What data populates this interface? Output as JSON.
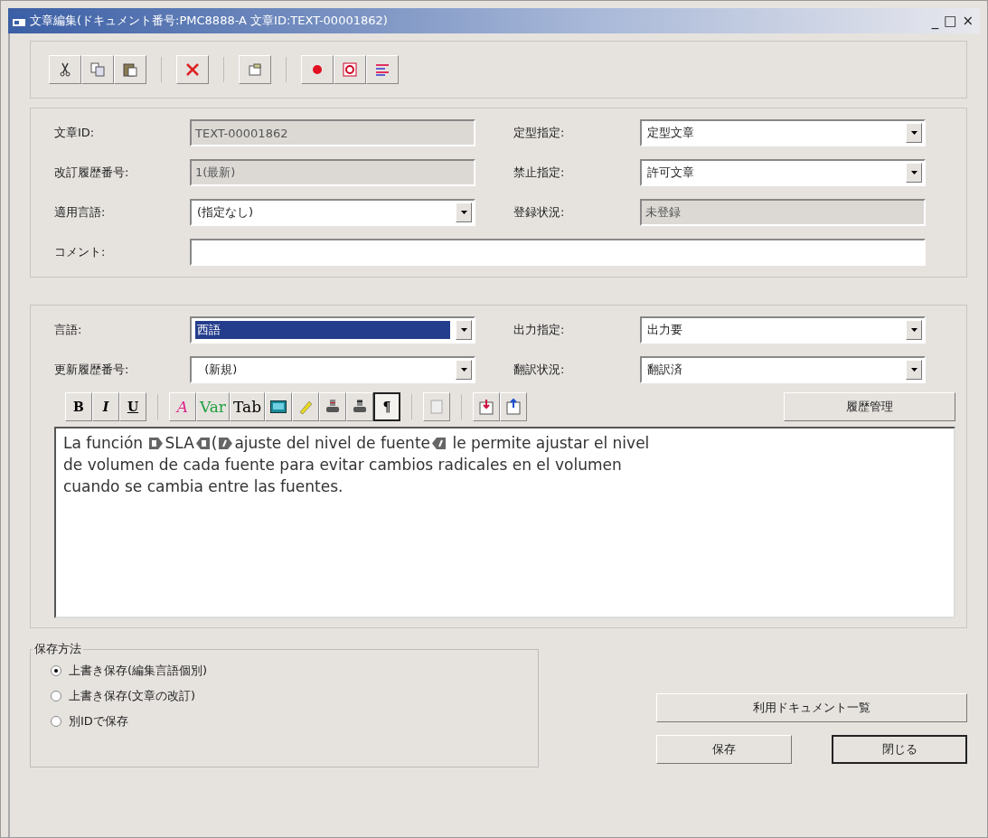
{
  "window": {
    "title": "文章編集(ドキュメント番号:PMC8888-A  文章ID:TEXT-00001862)",
    "controls": [
      "_",
      "□",
      "×"
    ]
  },
  "header_fields": [
    {
      "label": "文章ID:",
      "kind": "readonly",
      "value": "TEXT-00001862"
    },
    {
      "label": "定型指定:",
      "kind": "dropdown",
      "value": "定型文章"
    },
    {
      "label": "改訂履歴番号:",
      "kind": "readonly",
      "value": "1(最新)"
    },
    {
      "label": "禁止指定:",
      "kind": "dropdown",
      "value": "許可文章"
    },
    {
      "label": "適用言語:",
      "kind": "dropdown",
      "value": "(指定なし)"
    },
    {
      "label": "登録状況:",
      "kind": "readonly",
      "value": "未登録"
    }
  ],
  "comment": {
    "label": "コメント:"
  },
  "language_fields": [
    {
      "label": "言語:",
      "value": "西語",
      "highlighted": true
    },
    {
      "label": "出力指定:",
      "value": "出力要",
      "highlighted": false
    },
    {
      "label": "更新履歴番号:",
      "value": "  (新規)",
      "highlighted": false
    },
    {
      "label": "翻訳状況:",
      "value": "翻訳済",
      "highlighted": false
    }
  ],
  "format_toolbar": {
    "style_buttons": [
      "B",
      "I",
      "U"
    ],
    "insert_buttons": [
      "A",
      "Var",
      "Tab"
    ],
    "pilcrow": "¶",
    "pilcrow_pressed": true,
    "history_button": "履歴管理"
  },
  "editor": [
    [
      {
        "kind": "text",
        "text": "La función "
      },
      {
        "kind": "bold_open"
      },
      {
        "kind": "text",
        "text": "SLA"
      },
      {
        "kind": "bold_close"
      },
      {
        "kind": "text",
        "text": "("
      },
      {
        "kind": "italic_open"
      },
      {
        "kind": "text",
        "text": "ajuste del nivel de fuente"
      },
      {
        "kind": "italic_close"
      },
      {
        "kind": "text",
        "text": " le permite ajustar el nivel"
      }
    ],
    [
      {
        "kind": "text",
        "text": "de volumen de cada fuente para evitar cambios radicales en el volumen"
      }
    ],
    [
      {
        "kind": "text",
        "text": "cuando se cambia entre las fuentes."
      }
    ]
  ],
  "save_method": {
    "title": "保存方法",
    "options": [
      {
        "label": "上書き保存(編集言語個別)",
        "selected": true
      },
      {
        "label": "上書き保存(文章の改訂)",
        "selected": false
      },
      {
        "label": "別IDで保存",
        "selected": false
      }
    ]
  },
  "buttons": {
    "documents": "利用ドキュメント一覧",
    "save": "保存",
    "close": "閉じる"
  }
}
